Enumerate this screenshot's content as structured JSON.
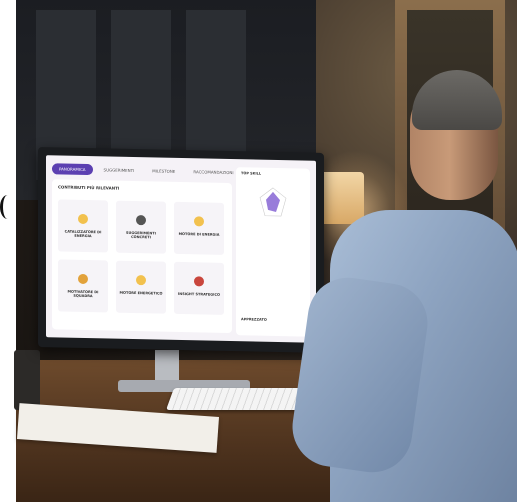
{
  "scene": {
    "description_kind": "photo",
    "colors": {
      "room": "#2a221b",
      "desk": "#5a3c24",
      "screen": "#f5f2f7",
      "accent": "#5b3fb1",
      "shirt": "#8ea4c1"
    }
  },
  "screen_ui": {
    "tabs": [
      "PANORAMICA",
      "SUGGERIMENTI",
      "MILESTONE",
      "RACCOMANDAZIONI"
    ],
    "panel_title": "CONTRIBUTI PIÙ RILEVANTI",
    "cards": [
      {
        "title": "CATALIZZATORE DI ENERGIA",
        "icon": "lightning-icon",
        "color": "#f2c14e"
      },
      {
        "title": "SUGGERIMENTI CONCRETI",
        "icon": "tools-icon",
        "color": "#555555"
      },
      {
        "title": "MOTORE DI ENERGIA",
        "icon": "lightning-icon",
        "color": "#f2c14e"
      },
      {
        "title": "MOTIVATORE DI SQUADRA",
        "icon": "heart-icon",
        "color": "#e2a23b"
      },
      {
        "title": "MOTORE ENERGETICO",
        "icon": "lightning-icon",
        "color": "#f2c14e"
      },
      {
        "title": "INSIGHT STRATEGICO",
        "icon": "target-icon",
        "color": "#c9463d"
      }
    ],
    "side_title": "TOP SKILL",
    "side_footer": "APPREZZATO"
  }
}
